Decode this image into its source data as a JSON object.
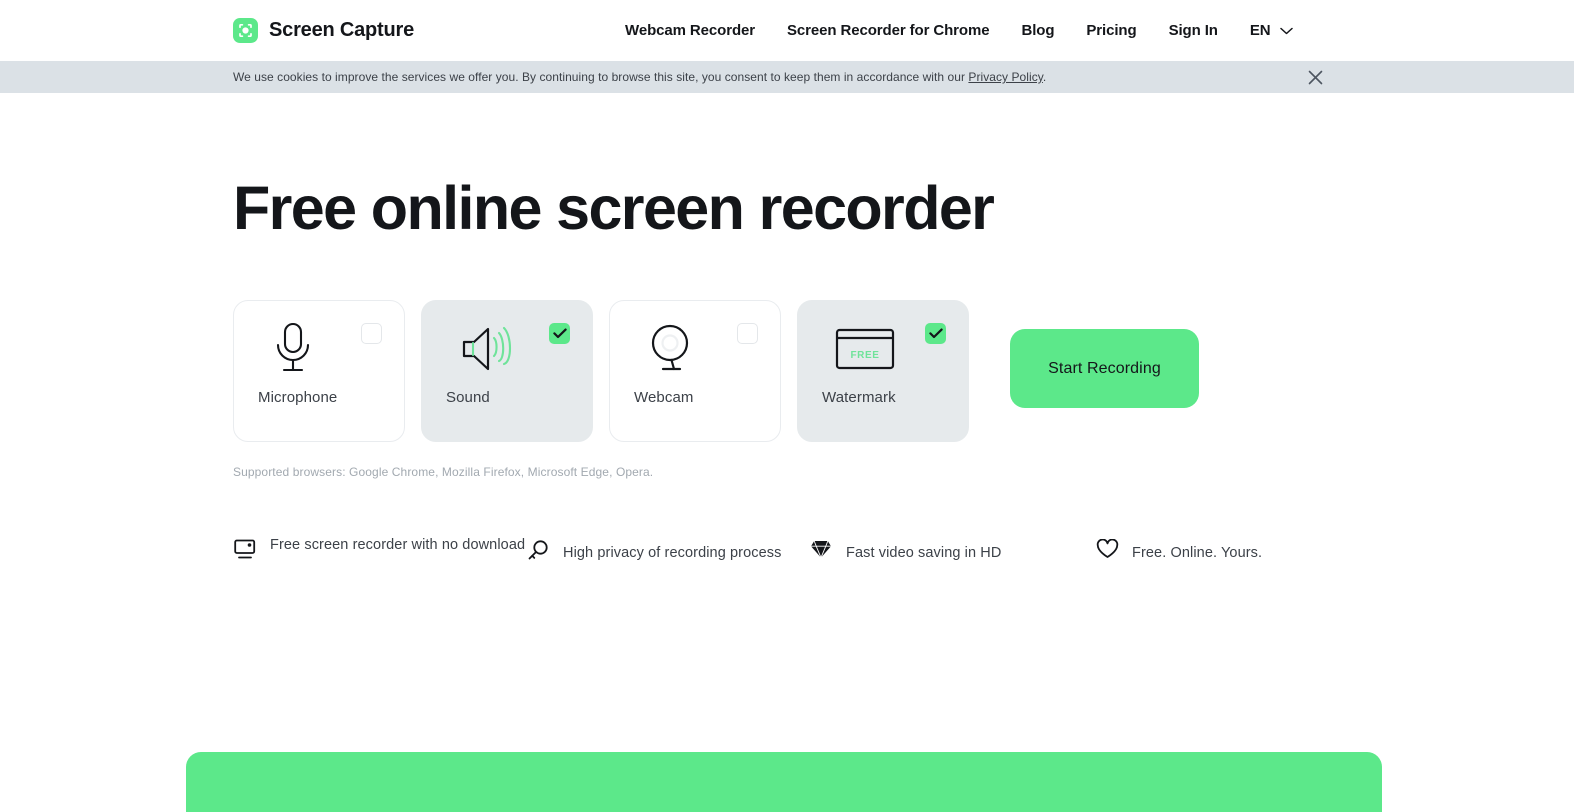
{
  "header": {
    "brand": "Screen Capture",
    "logo_icon": "screen-capture-logo-icon",
    "nav": [
      {
        "label": "Webcam Recorder",
        "name": "nav-webcam-recorder"
      },
      {
        "label": "Screen Recorder for Chrome",
        "name": "nav-screen-recorder-chrome"
      },
      {
        "label": "Blog",
        "name": "nav-blog"
      },
      {
        "label": "Pricing",
        "name": "nav-pricing"
      },
      {
        "label": "Sign In",
        "name": "nav-sign-in"
      }
    ],
    "language": "EN",
    "language_chevron": "chevron-down-icon"
  },
  "cookie": {
    "text": "We use cookies to improve the services we offer you. By continuing to browse this site, you consent to keep them in accordance with our ",
    "link": "Privacy Policy",
    "tail": ".",
    "close_icon": "close-icon",
    "background": "#dbe1e6"
  },
  "hero": {
    "title": "Free online screen recorder",
    "browsers_note": "Supported browsers: Google Chrome, Mozilla Firefox, Microsoft Edge, Opera."
  },
  "options": [
    {
      "label": "Microphone",
      "icon": "microphone-icon",
      "checked": false
    },
    {
      "label": "Sound",
      "icon": "speaker-sound-icon",
      "checked": true
    },
    {
      "label": "Webcam",
      "icon": "webcam-icon",
      "checked": false
    },
    {
      "label": "Watermark",
      "icon": "watermark-icon",
      "checked": true
    }
  ],
  "watermark_icon_text": "FREE",
  "cta": {
    "label": "Start Recording",
    "color": "#5ce88a"
  },
  "features": [
    {
      "text": "Free screen recorder with no download",
      "icon": "monitor-icon"
    },
    {
      "text": "High privacy of recording process",
      "icon": "magnifier-key-icon"
    },
    {
      "text": "Fast video saving in HD",
      "icon": "diamond-icon"
    },
    {
      "text": "Free. Online. Yours.",
      "icon": "heart-icon"
    }
  ],
  "colors": {
    "accent": "#5ce88a",
    "text": "#14161a",
    "muted": "#a2a9b0"
  }
}
